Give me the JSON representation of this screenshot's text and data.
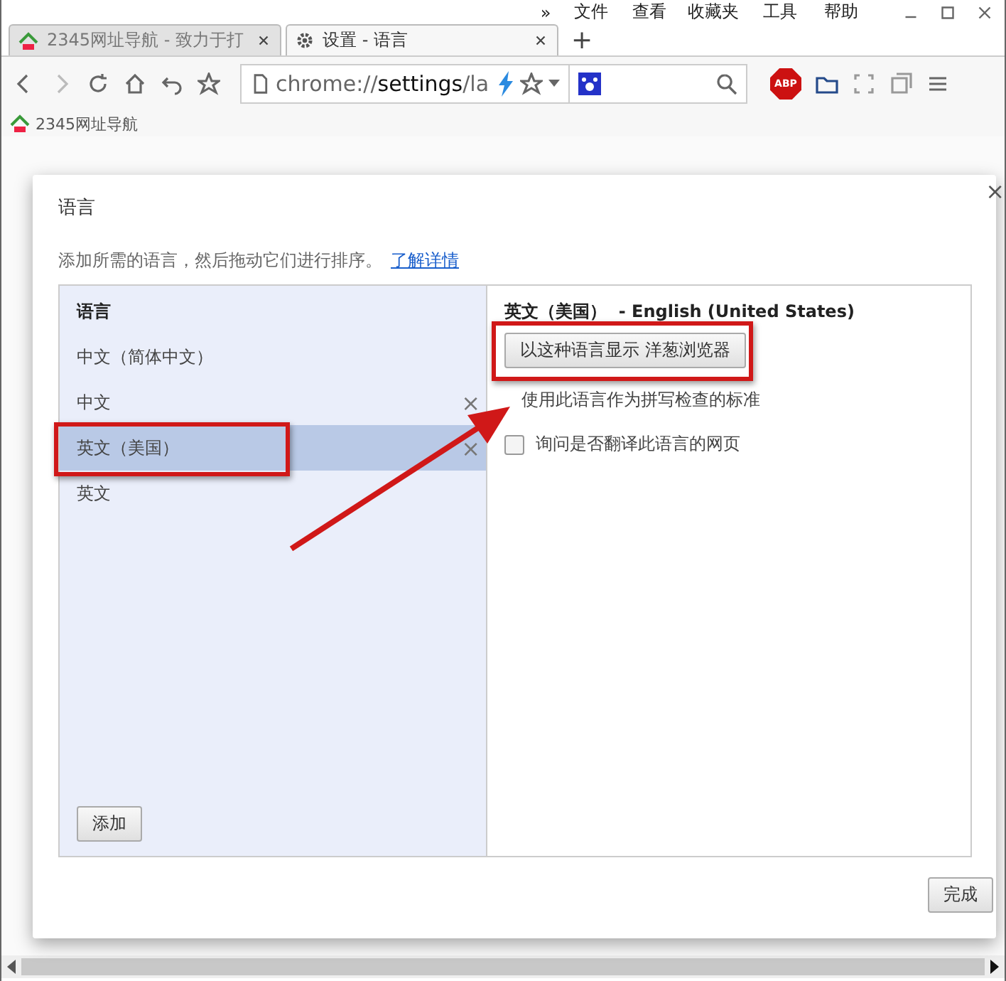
{
  "menu": [
    "»",
    "文件",
    "查看",
    "收藏夹",
    "工具",
    "帮助"
  ],
  "browser_tabs": [
    {
      "title": "2345网址导航 - 致力于打",
      "selected": false,
      "kind": "site"
    },
    {
      "title": "设置 - 语言",
      "selected": true,
      "kind": "settings"
    }
  ],
  "new_tab": "+",
  "address": {
    "scheme": "chrome://",
    "host": "settings",
    "path": "/la"
  },
  "extension_badge": "ABP",
  "bookmarks": [
    "2345网址导航"
  ],
  "dialog": {
    "title": "语言",
    "description": "添加所需的语言，然后拖动它们进行排序。",
    "link": "了解详情",
    "list_header": "语言",
    "languages": [
      {
        "name": "中文（简体中文）",
        "selected": false,
        "removable": false
      },
      {
        "name": "中文",
        "selected": false,
        "removable": true
      },
      {
        "name": "英文（美国）",
        "selected": true,
        "removable": true
      },
      {
        "name": "英文",
        "selected": false,
        "removable": false
      }
    ],
    "remove_glyph": "×",
    "add_button": "添加",
    "detail_title": "英文（美国）  - English (United States)",
    "display_button": "以这种语言显示 洋葱浏览器",
    "spellcheck_text": "使用此语言作为拼写检查的标准",
    "translate": {
      "label": "询问是否翻译此语言的网页",
      "checked": false
    },
    "done_button": "完成",
    "close_glyph": "×"
  }
}
